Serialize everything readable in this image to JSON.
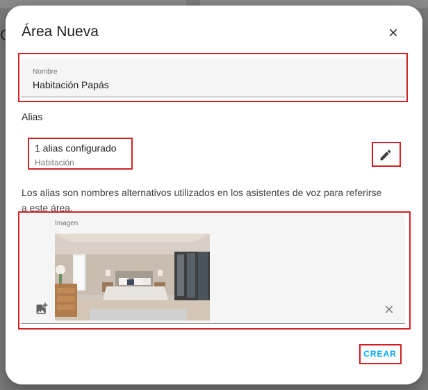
{
  "dialog": {
    "title": "Área Nueva",
    "close_icon": "close-icon"
  },
  "name_field": {
    "label": "Nombre",
    "value": "Habitación Papás"
  },
  "aliases": {
    "section_label": "Alias",
    "summary": "1 alias configurado",
    "values": "Habitación",
    "edit_icon": "pencil-icon",
    "helper": "Los alias son nombres alternativos utilizados en los asistentes de voz para referirse a este área."
  },
  "image_field": {
    "label": "Imagen",
    "add_icon": "add-image-icon",
    "remove_icon": "close-icon"
  },
  "actions": {
    "create_label": "CREAR"
  },
  "colors": {
    "accent": "#03a9f4",
    "highlight": "#d32027",
    "overlay": "#7b7b7b"
  }
}
